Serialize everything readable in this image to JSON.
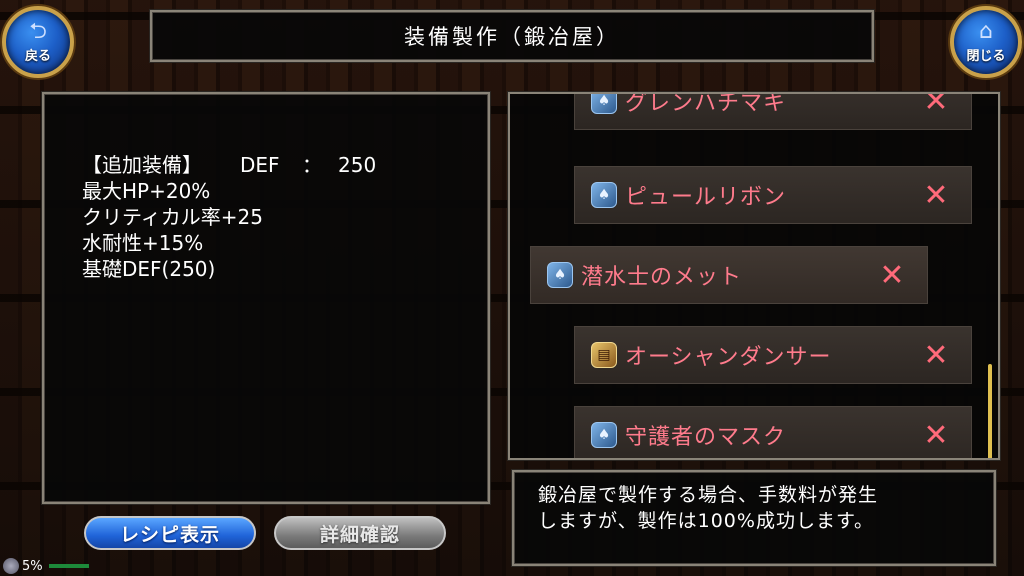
{
  "nav": {
    "back_label": "戻る",
    "close_label": "閉じる"
  },
  "title": "装備製作（鍛冶屋）",
  "detail": {
    "line1_label": "【追加装備】",
    "line1_stat": "DEF",
    "line1_colon": "：",
    "line1_value": "250",
    "lines": [
      "最大HP+20%",
      "クリティカル率+25",
      "水耐性+15%",
      "基礎DEF(250)"
    ]
  },
  "recipes": [
    {
      "name": "グレンハチマキ",
      "icon": "hat-icon",
      "mark": "✕"
    },
    {
      "name": "ピュールリボン",
      "icon": "hat-icon",
      "mark": "✕"
    },
    {
      "name": "潜水士のメット",
      "icon": "hat-icon",
      "mark": "✕",
      "selected": true
    },
    {
      "name": "オーシャンダンサー",
      "icon": "scroll-icon",
      "mark": "✕"
    },
    {
      "name": "守護者のマスク",
      "icon": "hat-icon",
      "mark": "✕"
    }
  ],
  "info": {
    "line1": "鍛冶屋で製作する場合、手数料が発生",
    "line2": "しますが、製作は100%成功します。"
  },
  "buttons": {
    "recipe": "レシピ表示",
    "detail": "詳細確認"
  },
  "status": {
    "percent": "5%"
  }
}
